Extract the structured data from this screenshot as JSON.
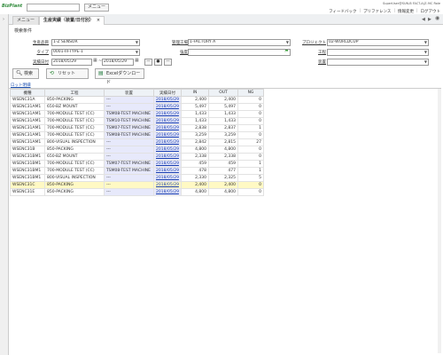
{
  "app": {
    "logo_text": "BizPlant",
    "menu_label": "メニュー",
    "user_info": "SuperUser@SUN-B FACT-A(Z-9IC Role",
    "links": [
      "フィードバック",
      "プリファレンス",
      "情報変更",
      "ログアウト"
    ]
  },
  "tabs": [
    {
      "label": "メニュー"
    },
    {
      "label": "生産実績（装置/日付別）",
      "close": "×"
    }
  ],
  "conditions": {
    "title": "検索条件",
    "fields": {
      "product_label": "生産品目",
      "product_value": "1-Z SENSOR",
      "factory_label": "管理工場",
      "factory_value": "1-FACTORY A",
      "project_label": "プロジェクト",
      "project_value": "02-WORLDCUP",
      "type_label": "タイプ",
      "type_value": "0001-III-TYPE-1",
      "quality_label": "強度",
      "quality_value": "",
      "process_label": "工程",
      "process_value": "",
      "date_label": "実績日付",
      "date_from": "2018/05/29",
      "date_to": "2018/05/29",
      "device_label": "装置",
      "device_value": ""
    },
    "buttons": {
      "search": "検索",
      "reset": "リセット",
      "excel": "Excelダウンロード"
    }
  },
  "sublink": "ロット明細",
  "table": {
    "headers": [
      "機種",
      "工程",
      "装置",
      "実績日付",
      "IN",
      "OUT",
      "NG"
    ],
    "rows": [
      [
        "WSENC31A",
        "850-PACKING",
        "---",
        "2018/05/29",
        "2,400",
        "2,400",
        "0"
      ],
      [
        "WSENC31AM1",
        "650-BZ MOUNT",
        "---",
        "2018/05/29",
        "5,497",
        "5,497",
        "0"
      ],
      [
        "WSENC31AM1",
        "700-MODULE TEST (CC)",
        "TSM08-TEST MACHINE",
        "2018/05/29",
        "1,433",
        "1,433",
        "0"
      ],
      [
        "WSENC31AM1",
        "700-MODULE TEST (CC)",
        "TSM10-TEST MACHINE",
        "2018/05/29",
        "1,433",
        "1,433",
        "0"
      ],
      [
        "WSENC31AM1",
        "700-MODULE TEST (CC)",
        "TSM07-TEST MACHINE",
        "2018/05/29",
        "2,838",
        "2,837",
        "1"
      ],
      [
        "WSENC31AM1",
        "700-MODULE TEST (CC)",
        "TSM08-TEST MACHINE",
        "2018/05/29",
        "3,259",
        "3,259",
        "0"
      ],
      [
        "WSENC31AM1",
        "800-VISUAL INSPECTION",
        "---",
        "2018/05/29",
        "2,842",
        "2,815",
        "27"
      ],
      [
        "WSENC31B",
        "850-PACKING",
        "---",
        "2018/05/29",
        "4,800",
        "4,800",
        "0"
      ],
      [
        "WSENC31BM1",
        "650-BZ MOUNT",
        "---",
        "2018/05/29",
        "2,338",
        "2,338",
        "0"
      ],
      [
        "WSENC31BM1",
        "700-MODULE TEST (CC)",
        "TSM07-TEST MACHINE",
        "2018/05/29",
        "459",
        "459",
        "1"
      ],
      [
        "WSENC31BM1",
        "700-MODULE TEST (CC)",
        "TSM08-TEST MACHINE",
        "2018/05/29",
        "478",
        "477",
        "1"
      ],
      [
        "WSENC31BM1",
        "800-VISUAL INSPECTION",
        "---",
        "2018/05/29",
        "2,330",
        "2,325",
        "5"
      ],
      [
        "WSENC31C",
        "850-PACKING",
        "---",
        "2018/05/29",
        "2,400",
        "2,400",
        "0"
      ],
      [
        "WSENC31E",
        "850-PACKING",
        "---",
        "2018/05/29",
        "4,800",
        "4,800",
        "0"
      ]
    ],
    "highlight_row": 12
  }
}
